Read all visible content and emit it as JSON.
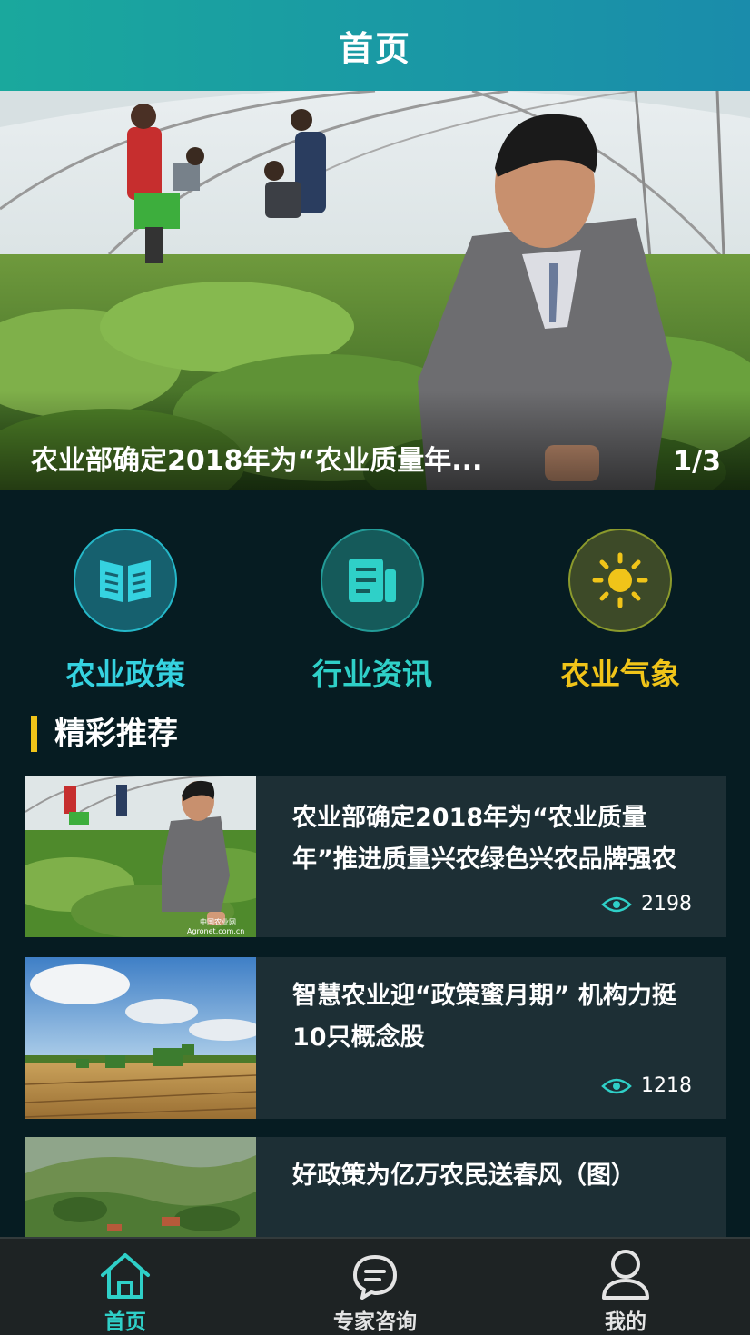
{
  "header": {
    "title": "首页"
  },
  "banner": {
    "caption": "农业部确定2018年为“农业质量年...",
    "pager": "1/3"
  },
  "categories": [
    {
      "label": "农业政策",
      "icon": "book-icon",
      "color": "#35d2e0"
    },
    {
      "label": "行业资讯",
      "icon": "news-icon",
      "color": "#2fd0c8"
    },
    {
      "label": "农业气象",
      "icon": "sun-icon",
      "color": "#f0c419"
    }
  ],
  "section": {
    "title": "精彩推荐"
  },
  "articles": [
    {
      "title": "农业部确定2018年为“农业质量年”推进质量兴农绿色兴农品牌强农",
      "views": "2198",
      "watermark": "中国农业网 Agronet.com.cn"
    },
    {
      "title": "智慧农业迎“政策蜜月期” 机构力挺10只概念股",
      "views": "1218"
    },
    {
      "title": "好政策为亿万农民送春风（图）",
      "views": ""
    }
  ],
  "tabbar": {
    "items": [
      {
        "label": "首页",
        "icon": "home-icon",
        "active": true
      },
      {
        "label": "专家咨询",
        "icon": "chat-icon",
        "active": false
      },
      {
        "label": "我的",
        "icon": "user-icon",
        "active": false
      }
    ]
  },
  "colors": {
    "accent": "#2fd0c8",
    "header_start": "#1aa89d",
    "header_end": "#1a8cab",
    "highlight": "#f0c419"
  }
}
